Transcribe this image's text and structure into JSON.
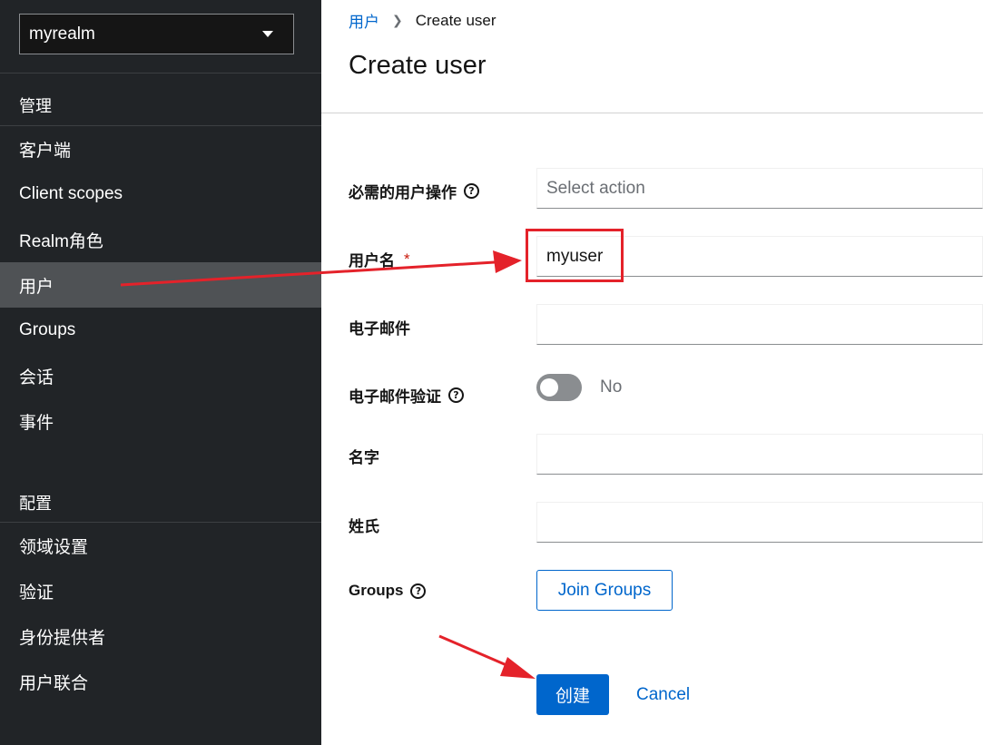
{
  "sidebar": {
    "realm": {
      "name": "myrealm"
    },
    "sections": [
      {
        "title": "管理"
      },
      {
        "title": "配置"
      }
    ],
    "items": [
      {
        "label": "客户端"
      },
      {
        "label": "Client scopes"
      },
      {
        "label": "Realm角色"
      },
      {
        "label": "用户"
      },
      {
        "label": "Groups"
      },
      {
        "label": "会话"
      },
      {
        "label": "事件"
      },
      {
        "label": "领域设置"
      },
      {
        "label": "验证"
      },
      {
        "label": "身份提供者"
      },
      {
        "label": "用户联合"
      }
    ],
    "active_item": "用户"
  },
  "breadcrumb": {
    "parent": "用户",
    "current": "Create user"
  },
  "page": {
    "title": "Create user"
  },
  "form": {
    "required_actions": {
      "label": "必需的用户操作",
      "placeholder": "Select action"
    },
    "username": {
      "label": "用户名",
      "required_mark": "*",
      "value": "myuser"
    },
    "email": {
      "label": "电子邮件",
      "value": ""
    },
    "email_verified": {
      "label": "电子邮件验证",
      "state_label": "No",
      "checked": false
    },
    "first_name": {
      "label": "名字",
      "value": ""
    },
    "last_name": {
      "label": "姓氏",
      "value": ""
    },
    "groups": {
      "label": "Groups",
      "button_label": "Join Groups"
    },
    "help_icon_glyph": "?"
  },
  "actions": {
    "create_label": "创建",
    "cancel_label": "Cancel"
  },
  "colors": {
    "sidebar_bg": "#212427",
    "active_bg": "#4f5255",
    "primary": "#0066cc",
    "annotation": "#e4222a"
  }
}
